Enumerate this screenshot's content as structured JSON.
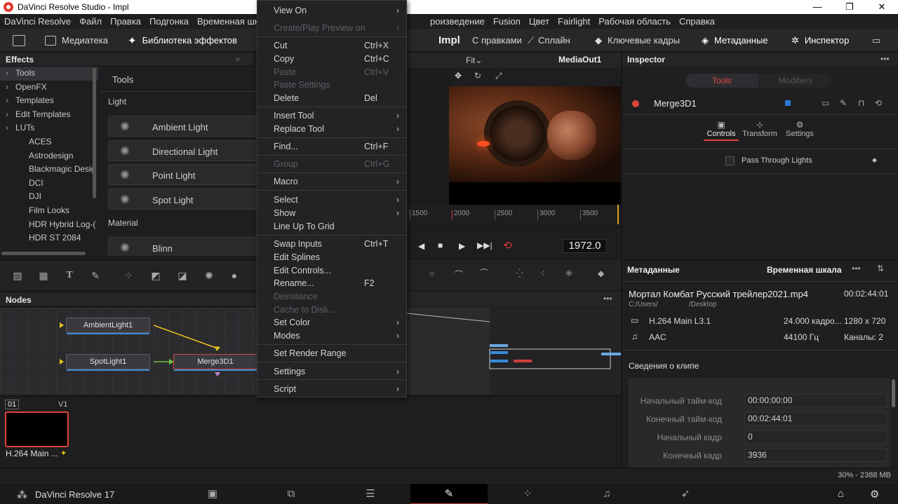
{
  "window": {
    "title": "DaVinci Resolve Studio - Impl",
    "controls": [
      "—",
      "❐",
      "✕"
    ]
  },
  "menubar": [
    "DaVinci Resolve",
    "Файл",
    "Правка",
    "Подгонка",
    "Временная шкала",
    "роизведение",
    "Fusion",
    "Цвет",
    "Fairlight",
    "Рабочая область",
    "Справка"
  ],
  "toolbar": {
    "media": "Медиатека",
    "effects_library": "Библиотека эффектов",
    "project": "Impl",
    "edits": "С правками",
    "spline": "Сплайн",
    "keyframes": "Ключевые кадры",
    "metadata": "Метаданные",
    "inspector": "Инспектор"
  },
  "effects": {
    "title": "Effects",
    "tree_top": [
      "Tools",
      "OpenFX",
      "Templates",
      "Edit Templates",
      "LUTs"
    ],
    "tree_sub": [
      "ACES",
      "Astrodesign",
      "Blackmagic Desig",
      "DCI",
      "DJI",
      "Film Looks",
      "HDR Hybrid Log-(",
      "HDR ST 2084"
    ],
    "list_title": "Tools",
    "section_light": "Light",
    "lights": [
      "Ambient Light",
      "Directional Light",
      "Point Light",
      "Spot Light"
    ],
    "section_material": "Material",
    "materials": [
      "Blinn"
    ]
  },
  "nodes": {
    "title": "Nodes",
    "n1": "AmbientLight1",
    "n2": "SpotLight1",
    "n3": "Merge3D1"
  },
  "viewer": {
    "fit": "Fit",
    "output": "MediaOut1",
    "ruler": [
      "1500",
      "2000",
      "2500",
      "3000",
      "3500"
    ],
    "timecode": "1972.0"
  },
  "inspector": {
    "title": "Inspector",
    "tab_tools": "Tools",
    "tab_modifiers": "Modifiers",
    "node_name": "Merge3D1",
    "sub_controls": "Controls",
    "sub_transform": "Transform",
    "sub_settings": "Settings",
    "pass_through": "Pass Through Lights"
  },
  "metadata": {
    "title": "Метаданные",
    "timeline_label": "Временная шкала",
    "filename": "Мортал Комбат Русский трейлер2021.mp4",
    "duration": "00:02:44:01",
    "path1": "C:/Users/",
    "path2": "/Desktop",
    "video_codec": "H.264 Main L3.1",
    "framerate": "24.000 кадро...",
    "resolution": "1280 x 720",
    "audio_codec": "AAC",
    "audio_rate": "44100 Гц",
    "channels": "Каналы: 2",
    "clip_info": "Сведения о клипе",
    "fields": [
      {
        "label": "Начальный тайм-код",
        "value": "00:00:00:00"
      },
      {
        "label": "Конечный тайм-код",
        "value": "00:02:44:01"
      },
      {
        "label": "Начальный кадр",
        "value": "0"
      },
      {
        "label": "Конечный кадр",
        "value": "3936"
      }
    ]
  },
  "clips": {
    "index": "01",
    "track": "V1",
    "clip_name": "H.264 Main ..."
  },
  "status": {
    "memory": "30% - 2388 MB"
  },
  "pagenav": {
    "app": "DaVinci Resolve 17"
  },
  "context_menu": {
    "items": [
      {
        "label": "View On",
        "key": "",
        "arrow": "›",
        "disabled": false
      },
      {
        "label": "Create/Play Preview on",
        "key": "",
        "arrow": "›",
        "disabled": true
      },
      {
        "label": "Cut",
        "key": "Ctrl+X",
        "arrow": "",
        "disabled": false
      },
      {
        "label": "Copy",
        "key": "Ctrl+C",
        "arrow": "",
        "disabled": false
      },
      {
        "label": "Paste",
        "key": "Ctrl+V",
        "arrow": "",
        "disabled": true
      },
      {
        "label": "Paste Settings",
        "key": "",
        "arrow": "",
        "disabled": true
      },
      {
        "label": "Delete",
        "key": "Del",
        "arrow": "",
        "disabled": false
      },
      {
        "label": "Insert Tool",
        "key": "",
        "arrow": "›",
        "disabled": false
      },
      {
        "label": "Replace Tool",
        "key": "",
        "arrow": "›",
        "disabled": false
      },
      {
        "label": "Find...",
        "key": "Ctrl+F",
        "arrow": "",
        "disabled": false
      },
      {
        "label": "Group",
        "key": "Ctrl+G",
        "arrow": "",
        "disabled": true
      },
      {
        "label": "Macro",
        "key": "",
        "arrow": "›",
        "disabled": false
      },
      {
        "label": "Select",
        "key": "",
        "arrow": "›",
        "disabled": false
      },
      {
        "label": "Show",
        "key": "",
        "arrow": "›",
        "disabled": false
      },
      {
        "label": "Line Up To Grid",
        "key": "",
        "arrow": "",
        "disabled": false
      },
      {
        "label": "Swap Inputs",
        "key": "Ctrl+T",
        "arrow": "",
        "disabled": false
      },
      {
        "label": "Edit Splines",
        "key": "",
        "arrow": "",
        "disabled": false
      },
      {
        "label": "Edit Controls...",
        "key": "",
        "arrow": "",
        "disabled": false
      },
      {
        "label": "Rename...",
        "key": "F2",
        "arrow": "",
        "disabled": false
      },
      {
        "label": "Deinstance",
        "key": "",
        "arrow": "",
        "disabled": true
      },
      {
        "label": "Cache to Disk...",
        "key": "",
        "arrow": "",
        "disabled": true
      },
      {
        "label": "Set Color",
        "key": "",
        "arrow": "›",
        "disabled": false
      },
      {
        "label": "Modes",
        "key": "",
        "arrow": "›",
        "disabled": false
      },
      {
        "label": "Set Render Range",
        "key": "",
        "arrow": "",
        "disabled": false
      },
      {
        "label": "Settings",
        "key": "",
        "arrow": "›",
        "disabled": false
      },
      {
        "label": "Script",
        "key": "",
        "arrow": "›",
        "disabled": false
      }
    ]
  }
}
